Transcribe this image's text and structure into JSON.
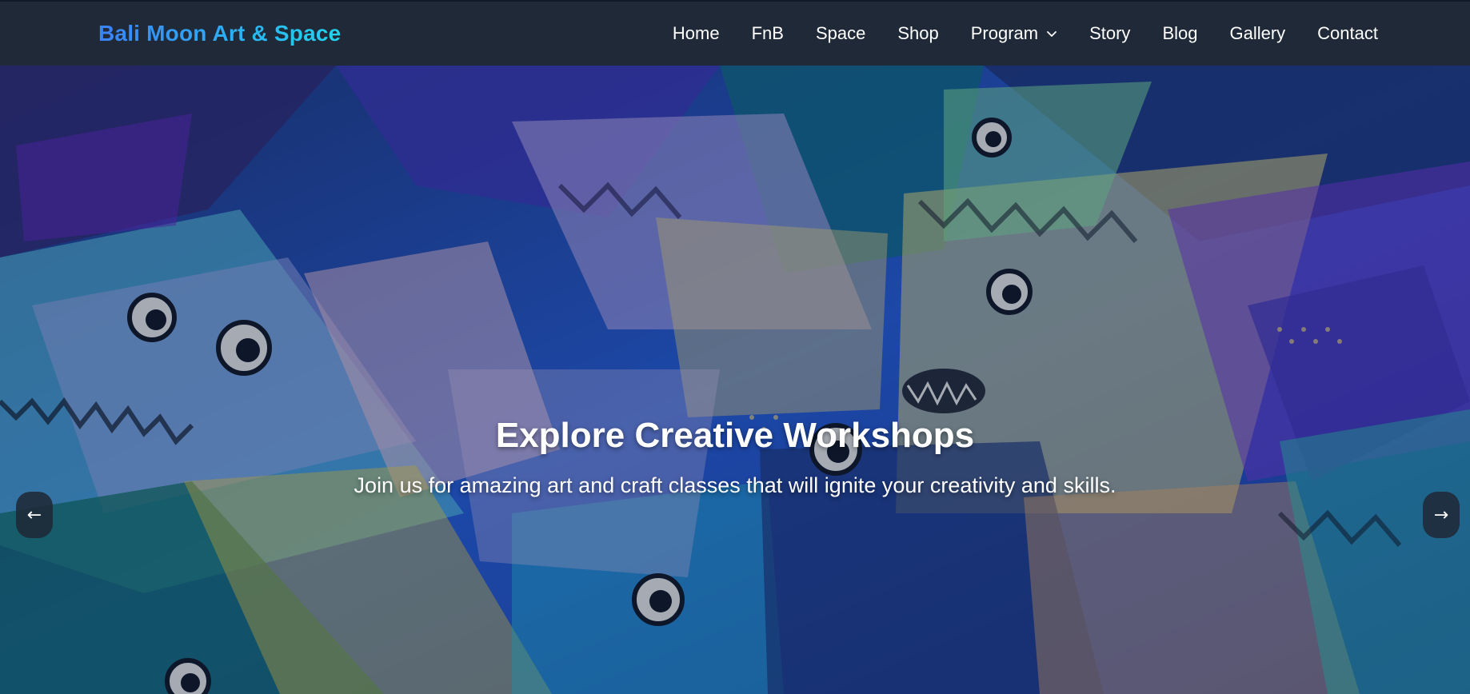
{
  "brand": {
    "name": "Bali Moon Art & Space",
    "gradient_from": "#3b82f6",
    "gradient_to": "#22d3ee"
  },
  "nav": {
    "items": [
      {
        "label": "Home"
      },
      {
        "label": "FnB"
      },
      {
        "label": "Space"
      },
      {
        "label": "Shop"
      },
      {
        "label": "Program",
        "has_dropdown": true,
        "icon": "chevron-down-icon"
      },
      {
        "label": "Story"
      },
      {
        "label": "Blog"
      },
      {
        "label": "Gallery"
      },
      {
        "label": "Contact"
      }
    ]
  },
  "hero": {
    "title": "Explore Creative Workshops",
    "subtitle": "Join us for amazing art and craft classes that will ignite your creativity and skills.",
    "background": "abstract painting of colorful fish with teeth",
    "prev_arrow": "←",
    "next_arrow": "→"
  },
  "colors": {
    "navbar_bg": "#1f2937",
    "text": "#ffffff"
  }
}
